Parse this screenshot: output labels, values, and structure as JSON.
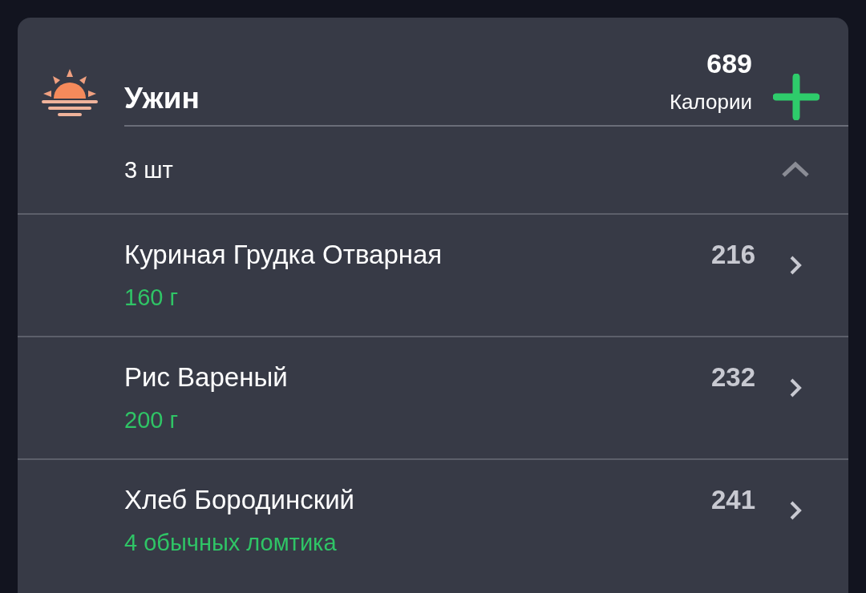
{
  "meal": {
    "title": "Ужин",
    "calories": "689",
    "calories_label": "Калории",
    "count": "3 шт",
    "expanded": true,
    "items": [
      {
        "name": "Куриная Грудка Отварная",
        "amount": "160 г",
        "calories": "216"
      },
      {
        "name": "Рис Вареный",
        "amount": "200 г",
        "calories": "232"
      },
      {
        "name": "Хлеб Бородинский",
        "amount": "4 обычных ломтика",
        "calories": "241"
      }
    ]
  }
}
